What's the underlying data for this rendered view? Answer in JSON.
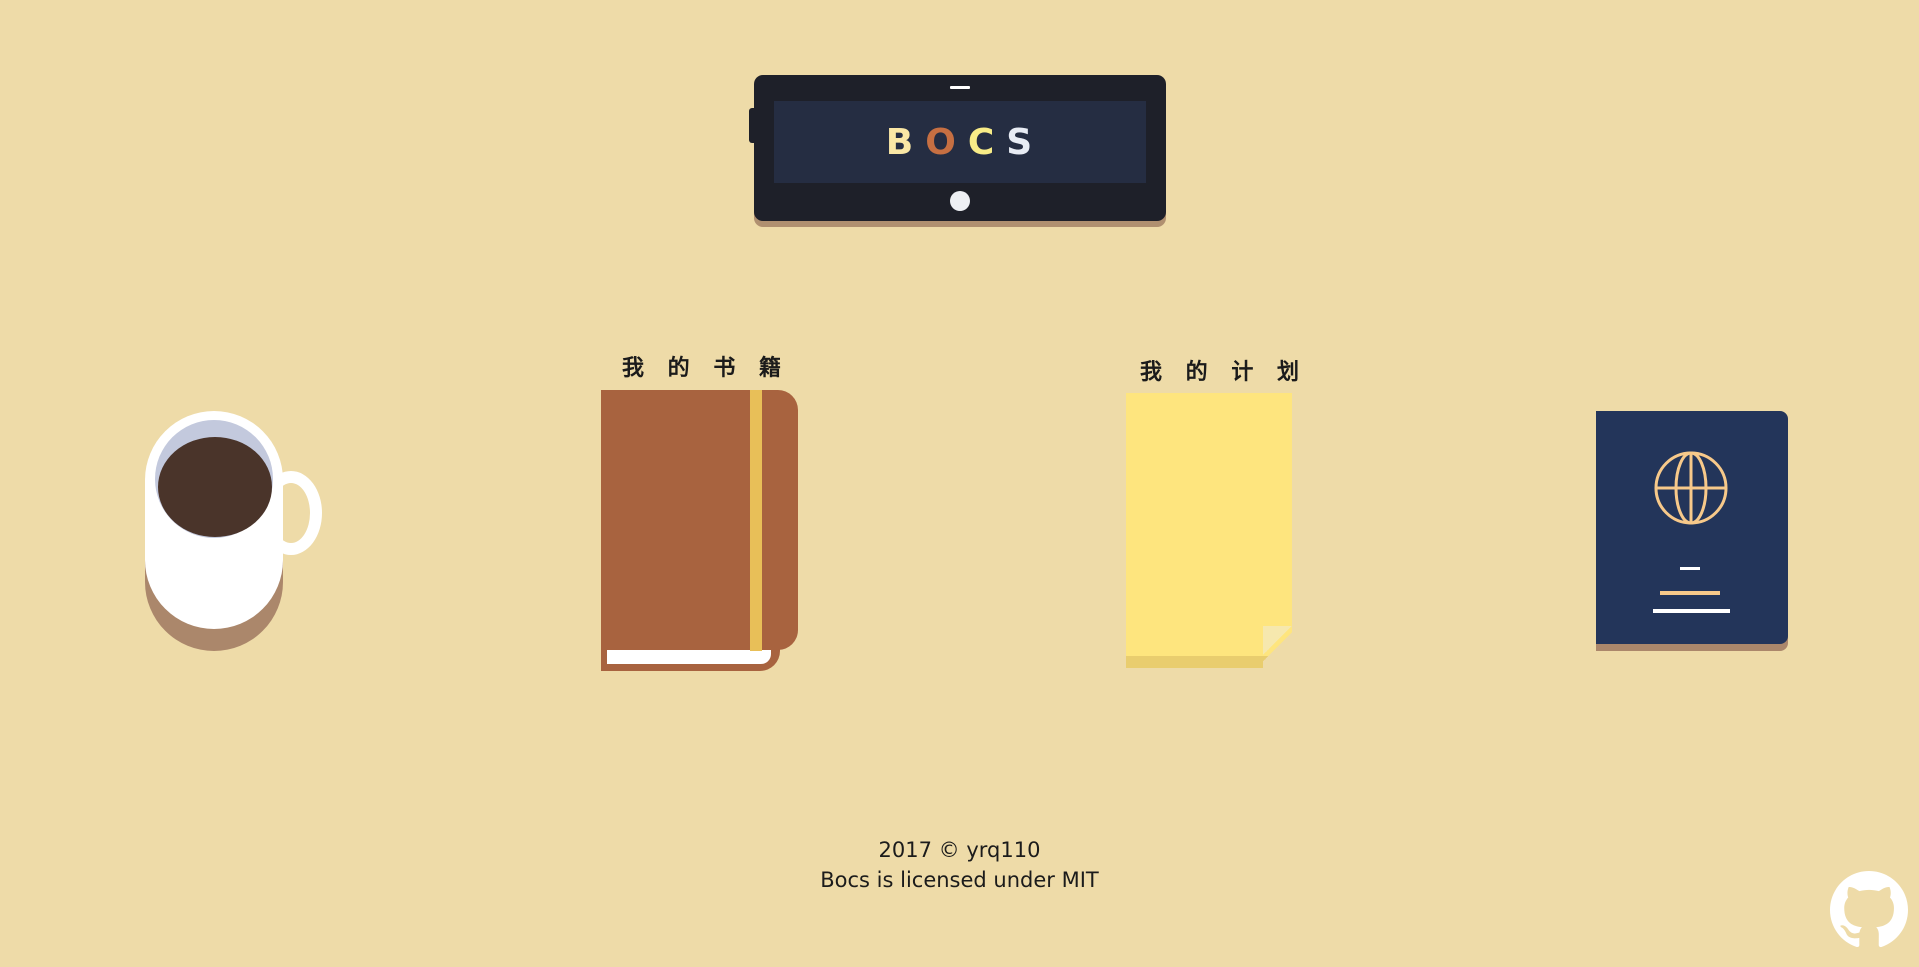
{
  "logo": {
    "letters": [
      {
        "char": "B",
        "color": "#fae7a5"
      },
      {
        "char": "O",
        "color": "#c66f42"
      },
      {
        "char": "C",
        "color": "#f8ec87"
      },
      {
        "char": "S",
        "color": "#e8ecf4"
      }
    ]
  },
  "sections": {
    "books": {
      "label": "我 的 书 籍"
    },
    "plans": {
      "label": "我 的 计 划"
    }
  },
  "footer": {
    "copyright": "2017 © yrq110",
    "license": "Bocs is licensed under MIT"
  },
  "icons": {
    "mug": "coffee-mug-icon",
    "book": "notebook-icon",
    "note": "sticky-note-icon",
    "passport": "passport-globe-icon",
    "github": "github-icon"
  },
  "colors": {
    "background": "#eedba8",
    "tablet": "#1e2029",
    "book": "#a8633f",
    "note": "#fee57e",
    "passport": "#23355a"
  }
}
